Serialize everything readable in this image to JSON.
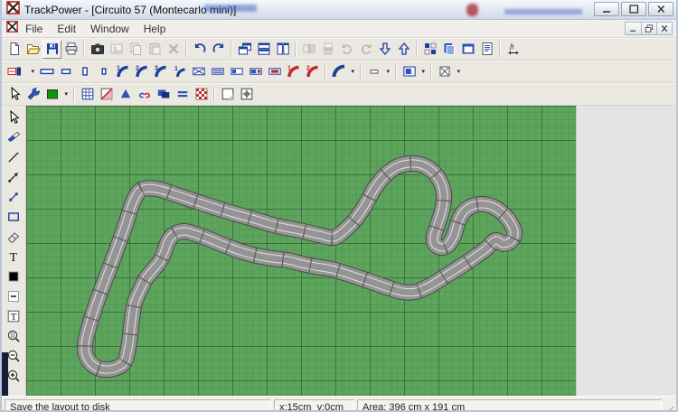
{
  "window": {
    "title": "TrackPower - [Circuito 57 (Montecarlo mini)]",
    "controls": {
      "minimize": "minimize",
      "maximize": "maximize",
      "close": "close"
    }
  },
  "menubar": {
    "items": [
      "File",
      "Edit",
      "Window",
      "Help"
    ],
    "mdi_controls": [
      "minimize",
      "restore",
      "close"
    ]
  },
  "toolbars": {
    "main": [
      {
        "icon": "new-document"
      },
      {
        "icon": "open-file"
      },
      {
        "icon": "save-file",
        "state": "hovered"
      },
      {
        "icon": "print"
      },
      {
        "sep": true
      },
      {
        "icon": "snapshot-camera"
      },
      {
        "icon": "insert-picture",
        "state": "disabled"
      },
      {
        "icon": "copy-pieces",
        "state": "disabled"
      },
      {
        "icon": "paste-pieces",
        "state": "disabled"
      },
      {
        "icon": "delete-pieces",
        "state": "disabled"
      },
      {
        "sep": true
      },
      {
        "icon": "undo"
      },
      {
        "icon": "redo"
      },
      {
        "sep": true
      },
      {
        "icon": "cascade-windows"
      },
      {
        "icon": "tile-horizontal"
      },
      {
        "icon": "tile-vertical"
      },
      {
        "sep": true
      },
      {
        "icon": "flip-horizontal",
        "state": "disabled"
      },
      {
        "icon": "flip-vertical",
        "state": "disabled"
      },
      {
        "icon": "rotate-left",
        "state": "disabled"
      },
      {
        "icon": "rotate-right",
        "state": "disabled"
      },
      {
        "icon": "move-down"
      },
      {
        "icon": "move-up"
      },
      {
        "sep": true
      },
      {
        "icon": "piece-grid"
      },
      {
        "icon": "copy-image"
      },
      {
        "icon": "export-window"
      },
      {
        "icon": "parts-list"
      },
      {
        "sep": true
      },
      {
        "icon": "measurement-units"
      }
    ],
    "pieces": [
      {
        "icon": "track-system",
        "wide": true,
        "caret": true
      },
      {
        "icon": "straight-full"
      },
      {
        "icon": "straight-standard"
      },
      {
        "icon": "straight-half"
      },
      {
        "icon": "straight-quarter"
      },
      {
        "icon": "curve-radius-1"
      },
      {
        "icon": "curve-radius-2"
      },
      {
        "icon": "curve-radius-3"
      },
      {
        "icon": "curve-inner-1"
      },
      {
        "icon": "crossing-track"
      },
      {
        "icon": "adapter-straight"
      },
      {
        "icon": "connector-straight"
      },
      {
        "icon": "connection-track"
      },
      {
        "icon": "terminal-track"
      },
      {
        "icon": "banked-curve-1"
      },
      {
        "icon": "banked-curve-2"
      },
      {
        "sep": true
      },
      {
        "icon": "curves-menu",
        "caret": true
      },
      {
        "sep": true
      },
      {
        "icon": "short-pieces-menu",
        "caret": true
      },
      {
        "sep": true
      },
      {
        "icon": "borders-menu",
        "caret": true
      },
      {
        "sep": true
      },
      {
        "icon": "special-pieces-menu",
        "caret": true
      }
    ],
    "view": [
      {
        "icon": "select-tool"
      },
      {
        "icon": "setup-tool"
      },
      {
        "icon": "color-picker",
        "caret": true
      },
      {
        "sep": true
      },
      {
        "icon": "show-grid"
      },
      {
        "icon": "snap-mode"
      },
      {
        "icon": "direction-marker"
      },
      {
        "icon": "show-markers"
      },
      {
        "icon": "show-borders"
      },
      {
        "icon": "show-lanes"
      },
      {
        "icon": "start-finish-line"
      },
      {
        "sep": true
      },
      {
        "icon": "full-window-view"
      },
      {
        "icon": "center-layout"
      }
    ],
    "draw": [
      {
        "icon": "select-tool"
      },
      {
        "icon": "move-pieces"
      },
      {
        "icon": "draw-line"
      },
      {
        "icon": "draw-arrow"
      },
      {
        "icon": "draw-double-arrow"
      },
      {
        "icon": "draw-rectangle"
      },
      {
        "icon": "eraser"
      },
      {
        "icon": "text-tool"
      },
      {
        "icon": "fill-color"
      },
      {
        "icon": "line-style"
      },
      {
        "icon": "framed-text"
      },
      {
        "icon": "zoom-fit"
      },
      {
        "icon": "zoom-out"
      },
      {
        "icon": "zoom-in"
      }
    ]
  },
  "statusbar": {
    "message": "Save the layout to disk",
    "cursor": "x:15cm  y:0cm",
    "area": "Area: 396 cm x 191 cm"
  },
  "colors": {
    "accent_navy": "#1b3f9e",
    "piece_red": "#c2282d",
    "canvas_green": "#5da45d",
    "grid_minor": "#4d8f4d",
    "grid_major": "#2f512f",
    "track_gray": "#949494",
    "track_border": "#4a4a4a",
    "slot_line": "#e5e0e5"
  }
}
